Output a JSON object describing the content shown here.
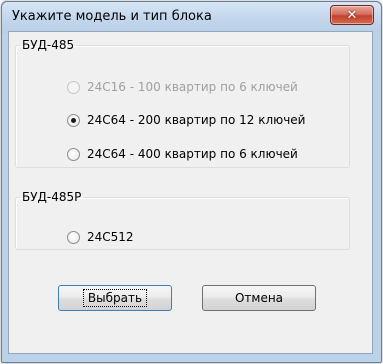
{
  "window": {
    "title": "Укажите модель и тип блока",
    "close_glyph": "✕"
  },
  "groups": [
    {
      "legend": "БУД-485",
      "options": [
        {
          "label": "24C16 - 100 квартир по 6 ключей",
          "checked": false,
          "disabled": true
        },
        {
          "label": "24C64 - 200 квартир по 12 ключей",
          "checked": true,
          "disabled": false
        },
        {
          "label": "24C64 - 400 квартир по 6 ключей",
          "checked": false,
          "disabled": false
        }
      ]
    },
    {
      "legend": "БУД-485Р",
      "options": [
        {
          "label": "24C512",
          "checked": false,
          "disabled": false
        }
      ]
    }
  ],
  "buttons": {
    "select": "Выбрать",
    "cancel": "Отмена"
  },
  "colors": {
    "close_button": "#c4412b",
    "window_frame": "#bcd2e9",
    "client_bg": "#f0f0f0"
  }
}
